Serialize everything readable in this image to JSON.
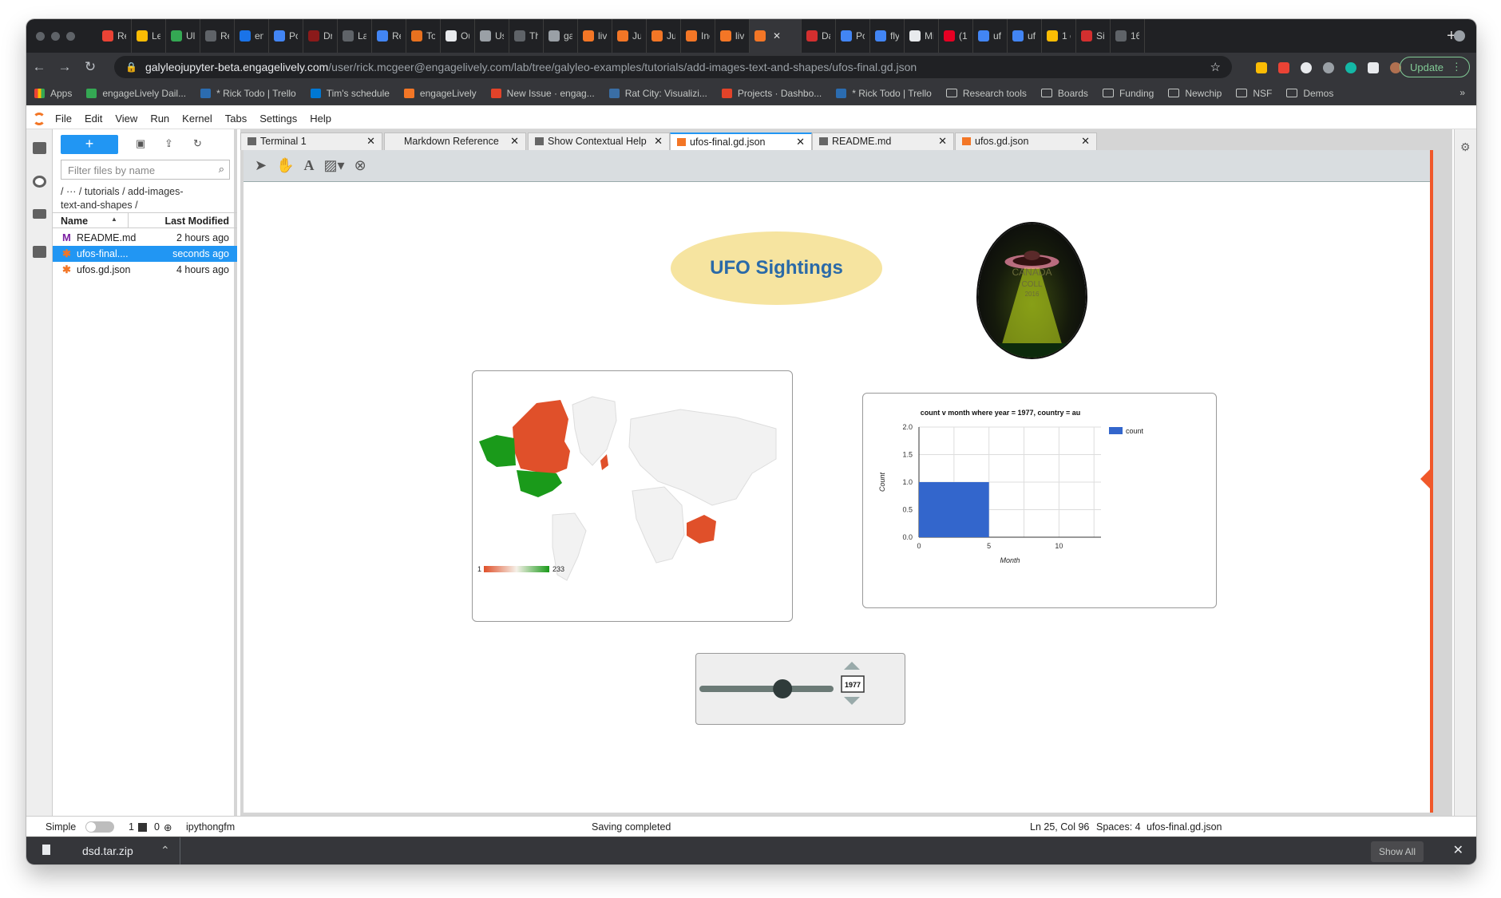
{
  "browser": {
    "tabs": [
      "Re",
      "Le",
      "Ul",
      "Re",
      "en",
      "Pc",
      "Dr",
      "La",
      "Re",
      "To",
      "Ou",
      "Us",
      "Th",
      "ga",
      "liv",
      "Ju",
      "Ju",
      "Inc",
      "liv",
      "",
      "Da",
      "Pc",
      "fly",
      "Mi",
      "(1(",
      "uf",
      "uf",
      "1 c",
      "Si",
      "16"
    ],
    "new_tab": "+",
    "url_host": "galyleojupyter-beta.engagelively.com",
    "url_path": "/user/rick.mcgeer@engagelively.com/lab/tree/galyleo-examples/tutorials/add-images-text-and-shapes/ufos-final.gd.json",
    "update_label": "Update",
    "bookmarks": [
      "Apps",
      "engageLively Dail...",
      "* Rick Todo | Trello",
      "Tim's schedule",
      "engageLively",
      "New Issue · engag...",
      "Rat City: Visualizi...",
      "Projects · Dashbo...",
      "* Rick Todo | Trello",
      "Research tools",
      "Boards",
      "Funding",
      "Newchip",
      "NSF",
      "Demos"
    ],
    "bookmark_more": "»"
  },
  "menu": [
    "File",
    "Edit",
    "View",
    "Run",
    "Kernel",
    "Tabs",
    "Settings",
    "Help"
  ],
  "filebrowser": {
    "new_label": "+",
    "filter_placeholder": "Filter files by name",
    "crumb_line1": "/   ···  / tutorials / add-images-",
    "crumb_line2": "text-and-shapes /",
    "col_name": "Name",
    "col_modified": "Last Modified",
    "files": [
      {
        "icon": "M",
        "name": "README.md",
        "modified": "2 hours ago"
      },
      {
        "icon": "✱",
        "name": "ufos-final....",
        "modified": "seconds ago"
      },
      {
        "icon": "✱",
        "name": "ufos.gd.json",
        "modified": "4 hours ago"
      }
    ]
  },
  "doc_tabs": [
    "Terminal 1",
    "Markdown Reference",
    "Show Contextual Help",
    "ufos-final.gd.json",
    "README.md",
    "ufos.gd.json"
  ],
  "dashboard": {
    "title": "UFO Sightings",
    "badge_text": [
      "CANADA",
      "COLL",
      "2016"
    ],
    "map_legend_min": "1",
    "map_legend_max": "233",
    "slider_value": "1977",
    "slider_min": 1900,
    "slider_max": 2014,
    "slider_fraction": 0.62
  },
  "chart_data": {
    "type": "bar",
    "title": "count v month where year = 1977, country = au",
    "xlabel": "Month",
    "ylabel": "Count",
    "xlim": [
      0,
      13
    ],
    "ylim": [
      0,
      2.0
    ],
    "xticks": [
      "0",
      "5",
      "10"
    ],
    "yticks": [
      "0.0",
      "0.5",
      "1.0",
      "1.5",
      "2.0"
    ],
    "series": [
      {
        "name": "count",
        "bars": [
          {
            "x0": 0,
            "x1": 5,
            "value": 1.0
          }
        ]
      }
    ],
    "legend": "right",
    "grid": true,
    "bar_color": "#3366cc"
  },
  "status": {
    "mode": "Simple",
    "terminals": "1",
    "kernels": "0",
    "kernel_name": "ipythongfm",
    "message": "Saving completed",
    "cursor": "Ln 25, Col 96",
    "spaces": "Spaces: 4",
    "file": "ufos-final.gd.json"
  },
  "downloads": {
    "file": "dsd.tar.zip",
    "show_all": "Show All"
  },
  "colors": {
    "jupyter_orange": "#f37626",
    "accent_blue": "#2196f3",
    "map_high": "#1a9a1a",
    "map_low": "#e0502a"
  }
}
